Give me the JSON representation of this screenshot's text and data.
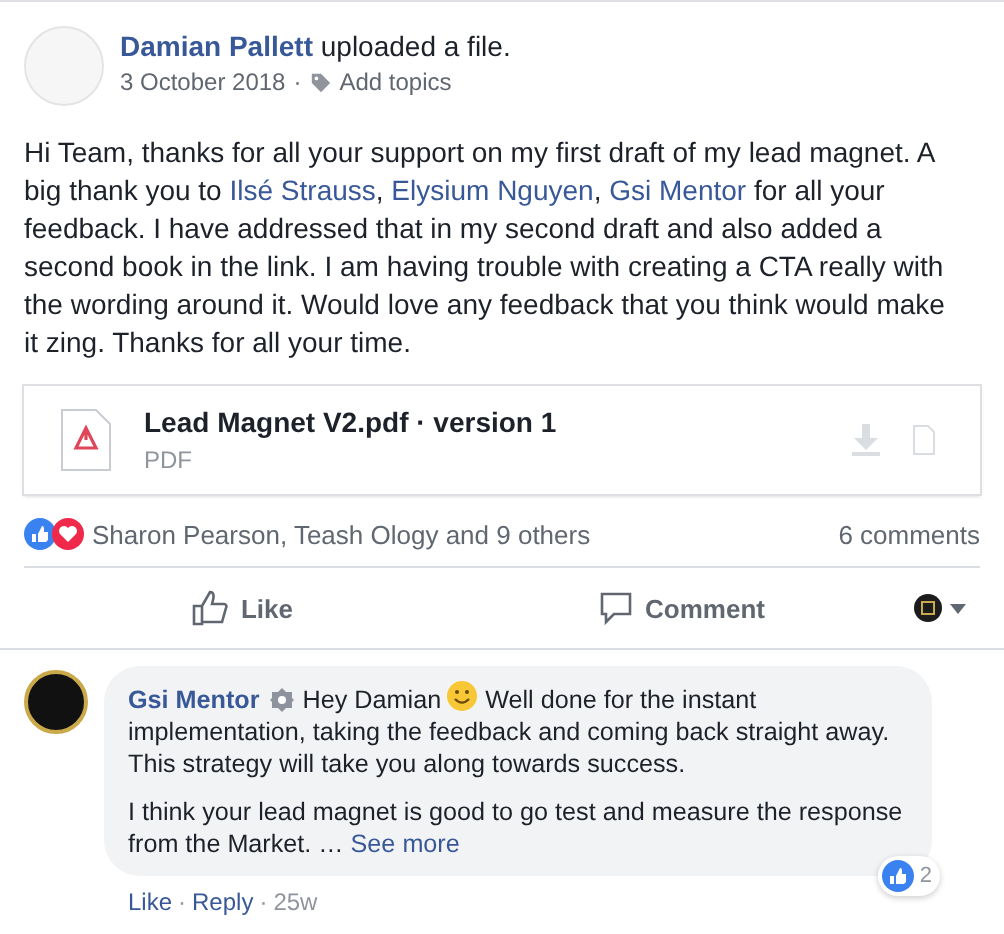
{
  "post": {
    "author": "Damian Pallett",
    "action": "uploaded a file.",
    "date": "3 October 2018",
    "separator": "·",
    "topics_link": "Add topics",
    "body": [
      {
        "kind": "text",
        "text": "Hi Team, thanks for all your support on my first draft of my lead magnet. A big thank you to "
      },
      {
        "kind": "link",
        "text": "Ilsé Strauss"
      },
      {
        "kind": "text",
        "text": ", "
      },
      {
        "kind": "link",
        "text": "Elysium Nguyen"
      },
      {
        "kind": "text",
        "text": ", "
      },
      {
        "kind": "link",
        "text": "Gsi Mentor"
      },
      {
        "kind": "text",
        "text": " for all your feedback. I have addressed that in my second draft and also added a second book in the link. I am having trouble with creating a CTA really with the wording around it. Would love any feedback that you think would make it zing. Thanks for all your time."
      }
    ]
  },
  "file": {
    "name": "Lead Magnet V2.pdf · version 1",
    "type": "PDF"
  },
  "reactions": {
    "names": "Sharon Pearson, Teash Ology and 9 others",
    "comments": "6 comments"
  },
  "actions": [
    {
      "kind": "like",
      "label": "Like"
    },
    {
      "kind": "comment",
      "label": "Comment"
    }
  ],
  "comment": {
    "author": "Gsi Mentor",
    "paragraphs": [
      [
        {
          "kind": "text",
          "text": "Hey Damian"
        },
        {
          "kind": "smile"
        },
        {
          "kind": "text",
          "text": "Well done for the instant implementation, taking the feedback and coming back straight away. This strategy will take you along towards success."
        }
      ],
      [
        {
          "kind": "text",
          "text": "I think your lead magnet is good to go test and measure the response from the Market. … "
        },
        {
          "kind": "link",
          "text": "See more"
        }
      ]
    ],
    "like_count": "2",
    "separator": "·",
    "links": [
      "Like",
      "Reply"
    ],
    "age": "25w"
  }
}
